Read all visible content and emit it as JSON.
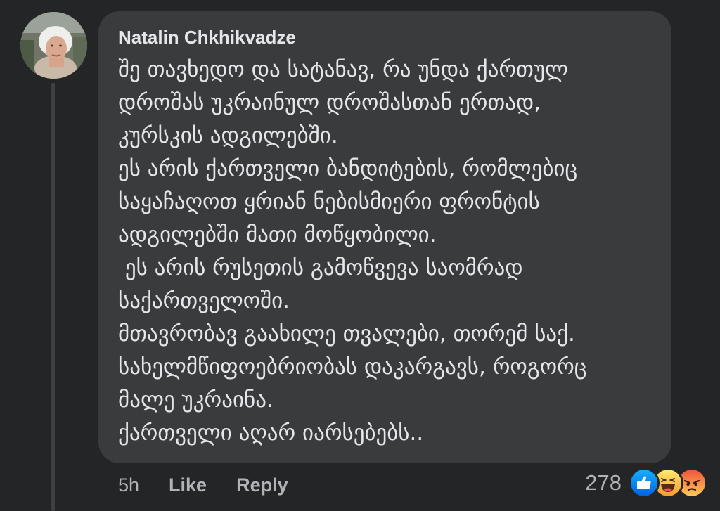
{
  "comment": {
    "author": "Natalin Chkhikvadze",
    "lines": [
      "შე თავხედო და სატანავ, რა უნდა ქართულ",
      "დროშას უკრაინულ დროშასთან ერთად,",
      "კურსკის ადგილებში.",
      "ეს არის ქართველი ბანდიტების, რომლებიც",
      "საყაჩაღოთ ყრიან ნებისმიერი ფრონტის",
      "ადგილებში მათი მოწყობილი.",
      " ეს არის რუსეთის გამოწვევა საომრად",
      "საქართველოში.",
      "მთავრობავ გაახილე თვალები, თორემ საქ.",
      "სახელმწიფოებრიობას დაკარგავს, როგორც",
      "მალე უკრაინა.",
      "ქართველი აღარ იარსებებს.."
    ]
  },
  "actions": {
    "time": "5h",
    "like_label": "Like",
    "reply_label": "Reply"
  },
  "reactions": {
    "count": "278",
    "icons": [
      "like-reaction-icon",
      "haha-reaction-icon",
      "angry-reaction-icon"
    ]
  },
  "colors": {
    "background": "#242526",
    "bubble": "#3a3b3c",
    "primary_text": "#e4e6eb",
    "secondary_text": "#b0b3b8",
    "like_blue": "#1877f2"
  }
}
